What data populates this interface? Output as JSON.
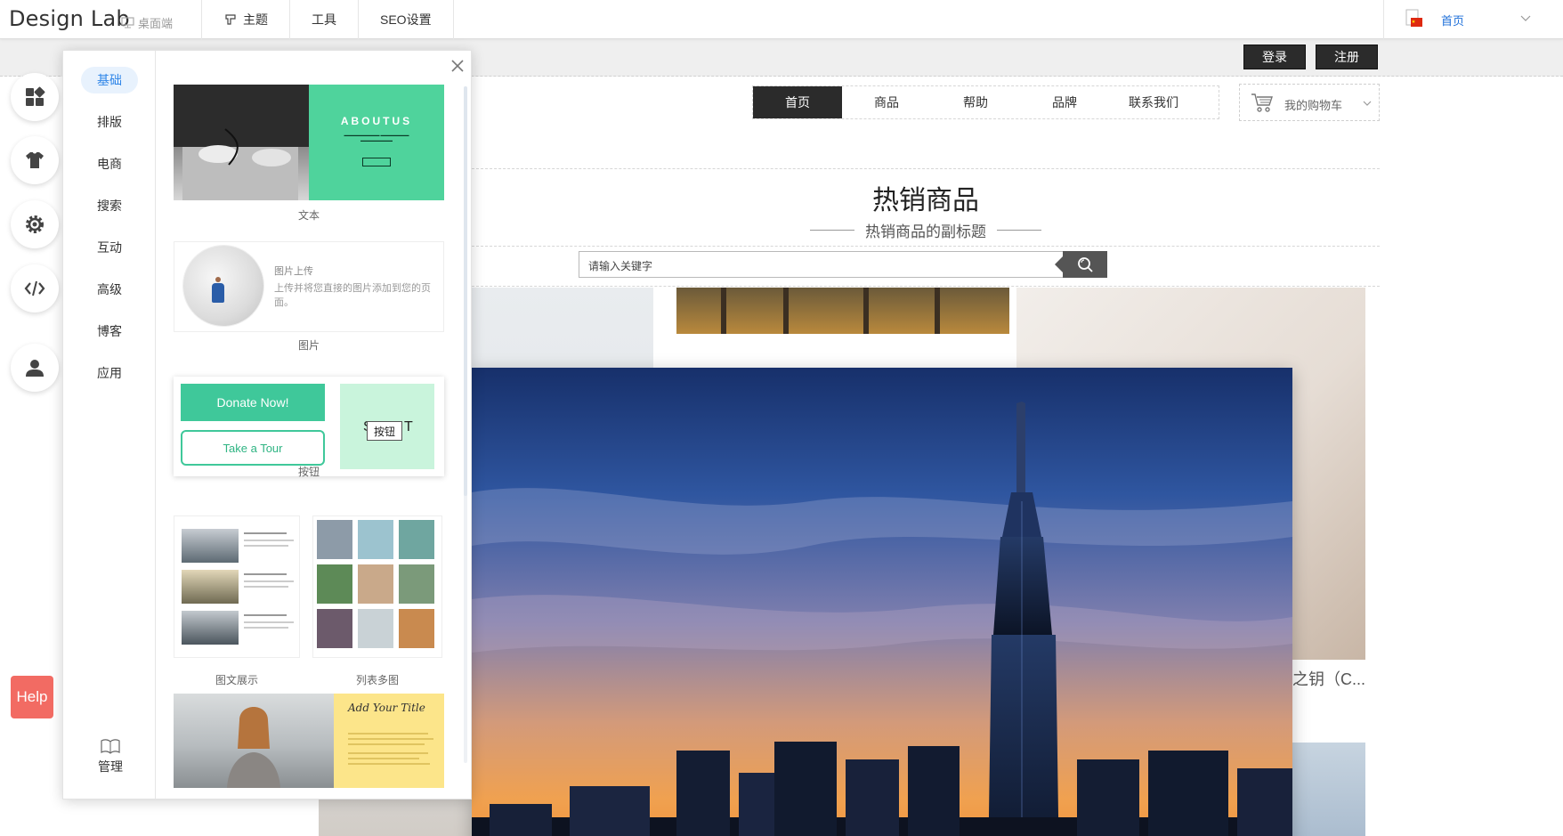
{
  "app": {
    "brand": "Design Lab",
    "desktop_label": "桌面端"
  },
  "topnav": [
    {
      "label": "主题",
      "icon": "theme-icon"
    },
    {
      "label": "工具",
      "icon": ""
    },
    {
      "label": "SEO设置",
      "icon": ""
    }
  ],
  "page_select": {
    "current": "首页"
  },
  "site": {
    "login": "登录",
    "register": "注册",
    "nav": [
      "首页",
      "商品",
      "帮助",
      "品牌",
      "联系我们"
    ],
    "nav_active": "首页",
    "cart": "我的购物车",
    "section_title": "热销商品",
    "section_subtitle": "热销商品的副标题",
    "search_placeholder": "请输入关键字",
    "product_caption": "之钥（C..."
  },
  "rail": [
    "apps-icon",
    "shirt-icon",
    "gear-icon",
    "code-icon",
    "user-icon"
  ],
  "help": "Help",
  "panel": {
    "categories": [
      "基础",
      "排版",
      "电商",
      "搜索",
      "互动",
      "高级",
      "博客",
      "应用"
    ],
    "active_category": "基础",
    "manage": "管理",
    "modules": {
      "text": {
        "caption": "文本",
        "about_title": "ABOUTUS"
      },
      "image": {
        "caption": "图片",
        "title": "图片上传",
        "desc": "上传并将您直接的图片添加到您的页面。"
      },
      "button": {
        "caption": "按钮",
        "donate": "Donate Now!",
        "tour": "Take a Tour",
        "badge": "按钮",
        "s": "S",
        "t": "T"
      },
      "image_text": {
        "caption": "图文展示"
      },
      "list_images": {
        "caption": "列表多图"
      },
      "bottom": {
        "title": "Add Your Title"
      }
    }
  },
  "colors": {
    "accent": "#2f86e8",
    "green": "#3fc89a",
    "help": "#f26b63",
    "dark": "#2b2b2b"
  }
}
